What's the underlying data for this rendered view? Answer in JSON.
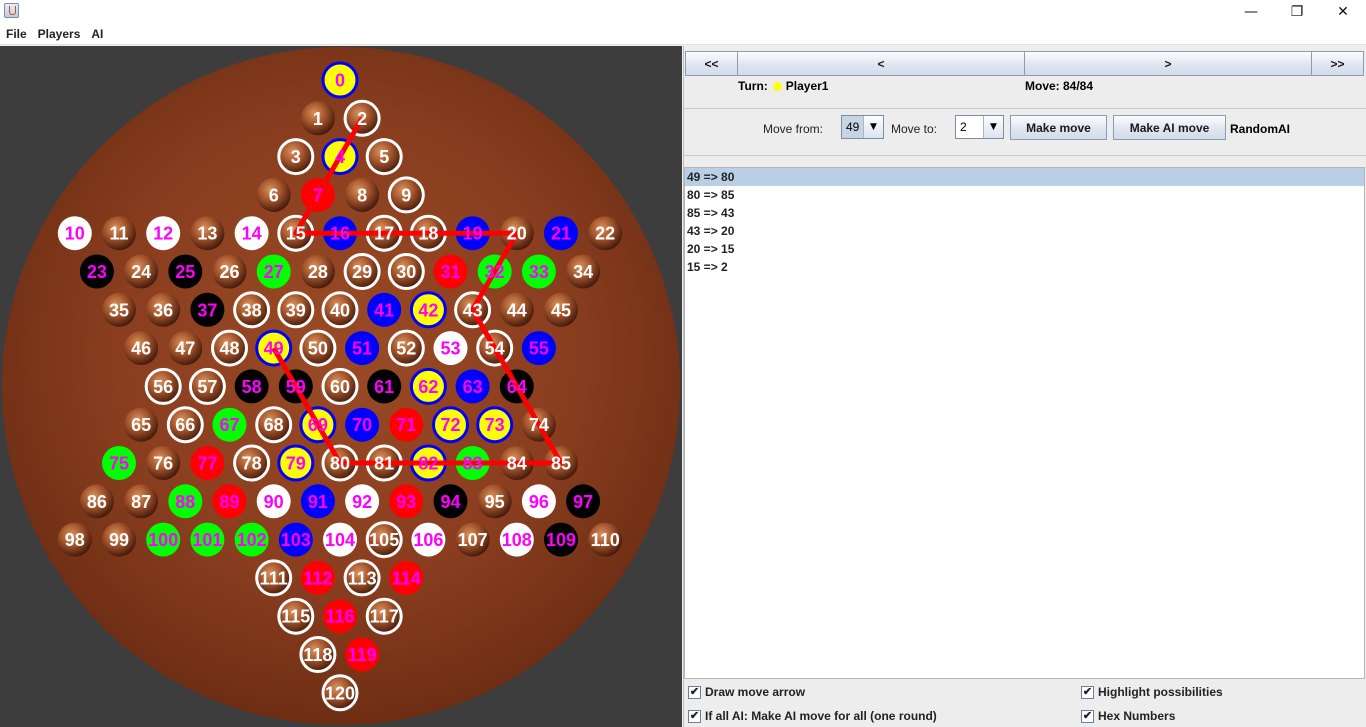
{
  "window": {
    "title": "",
    "min_glyph": "—",
    "restore_glyph": "❐",
    "close_glyph": "✕"
  },
  "menu": [
    "File",
    "Players",
    "AI"
  ],
  "nav": {
    "first": "<<",
    "prev": "<",
    "next": ">",
    "last": ">>"
  },
  "status": {
    "turn_label": "Turn:",
    "player": "Player1",
    "player_color": "#ffff00",
    "move_label": "Move: 84/84"
  },
  "controls": {
    "move_from_label": "Move from:",
    "move_from_value": "49",
    "move_to_label": "Move to:",
    "move_to_value": "2",
    "make_move": "Make move",
    "make_ai_move": "Make AI move",
    "ai_name": "RandomAI"
  },
  "history": [
    "49 => 80",
    "80 => 85",
    "85 => 43",
    "43 => 20",
    "20 => 15",
    "15 => 2"
  ],
  "history_selected": 0,
  "options": {
    "draw_arrow": "Draw move arrow",
    "highlight": "Highlight possibilities",
    "ai_all": "If all AI: Make AI move for all (one round)",
    "hex": "Hex Numbers"
  },
  "board": {
    "colors": {
      "yellow": "#ffff00",
      "blue": "#0000ff",
      "red": "#ff0000",
      "green": "#00ff00",
      "black": "#000000",
      "white": "#ffffff",
      "label_magenta": "#ff00ff",
      "wood": "#8a3e1f",
      "path": "#ff0000"
    },
    "rows": [
      1,
      2,
      3,
      4,
      13,
      12,
      11,
      10,
      9,
      10,
      11,
      12,
      13,
      4,
      3,
      2,
      1
    ],
    "cells": [
      {
        "n": "0",
        "fill": "yellow",
        "ring": "blue"
      },
      {
        "n": "1",
        "fill": "empty"
      },
      {
        "n": "2",
        "fill": "empty",
        "ring": "white"
      },
      {
        "n": "3",
        "fill": "empty",
        "ring": "white"
      },
      {
        "n": "4",
        "fill": "yellow",
        "ring": "blue"
      },
      {
        "n": "5",
        "fill": "empty",
        "ring": "white"
      },
      {
        "n": "6",
        "fill": "empty"
      },
      {
        "n": "7",
        "fill": "red"
      },
      {
        "n": "8",
        "fill": "empty"
      },
      {
        "n": "9",
        "fill": "empty",
        "ring": "white"
      },
      {
        "n": "10",
        "fill": "white"
      },
      {
        "n": "11",
        "fill": "empty"
      },
      {
        "n": "12",
        "fill": "white"
      },
      {
        "n": "13",
        "fill": "empty"
      },
      {
        "n": "14",
        "fill": "white"
      },
      {
        "n": "15",
        "fill": "empty",
        "ring": "white"
      },
      {
        "n": "16",
        "fill": "blue"
      },
      {
        "n": "17",
        "fill": "empty",
        "ring": "white"
      },
      {
        "n": "18",
        "fill": "empty",
        "ring": "white"
      },
      {
        "n": "19",
        "fill": "blue"
      },
      {
        "n": "20",
        "fill": "empty"
      },
      {
        "n": "21",
        "fill": "blue"
      },
      {
        "n": "22",
        "fill": "empty"
      },
      {
        "n": "23",
        "fill": "black"
      },
      {
        "n": "24",
        "fill": "empty"
      },
      {
        "n": "25",
        "fill": "black"
      },
      {
        "n": "26",
        "fill": "empty"
      },
      {
        "n": "27",
        "fill": "green"
      },
      {
        "n": "28",
        "fill": "empty"
      },
      {
        "n": "29",
        "fill": "empty",
        "ring": "white"
      },
      {
        "n": "30",
        "fill": "empty",
        "ring": "white"
      },
      {
        "n": "31",
        "fill": "red"
      },
      {
        "n": "32",
        "fill": "green"
      },
      {
        "n": "33",
        "fill": "green"
      },
      {
        "n": "34",
        "fill": "empty"
      },
      {
        "n": "35",
        "fill": "empty"
      },
      {
        "n": "36",
        "fill": "empty"
      },
      {
        "n": "37",
        "fill": "black"
      },
      {
        "n": "38",
        "fill": "empty",
        "ring": "white"
      },
      {
        "n": "39",
        "fill": "empty",
        "ring": "white"
      },
      {
        "n": "40",
        "fill": "empty",
        "ring": "white"
      },
      {
        "n": "41",
        "fill": "blue"
      },
      {
        "n": "42",
        "fill": "yellow",
        "ring": "blue"
      },
      {
        "n": "43",
        "fill": "empty",
        "ring": "white"
      },
      {
        "n": "44",
        "fill": "empty"
      },
      {
        "n": "45",
        "fill": "empty"
      },
      {
        "n": "46",
        "fill": "empty"
      },
      {
        "n": "47",
        "fill": "empty"
      },
      {
        "n": "48",
        "fill": "empty",
        "ring": "white"
      },
      {
        "n": "49",
        "fill": "yellow",
        "ring": "blue"
      },
      {
        "n": "50",
        "fill": "empty",
        "ring": "white"
      },
      {
        "n": "51",
        "fill": "blue"
      },
      {
        "n": "52",
        "fill": "empty",
        "ring": "white"
      },
      {
        "n": "53",
        "fill": "white"
      },
      {
        "n": "54",
        "fill": "empty",
        "ring": "white"
      },
      {
        "n": "55",
        "fill": "blue"
      },
      {
        "n": "56",
        "fill": "empty",
        "ring": "white"
      },
      {
        "n": "57",
        "fill": "empty",
        "ring": "white"
      },
      {
        "n": "58",
        "fill": "black"
      },
      {
        "n": "59",
        "fill": "black"
      },
      {
        "n": "60",
        "fill": "empty",
        "ring": "white"
      },
      {
        "n": "61",
        "fill": "black"
      },
      {
        "n": "62",
        "fill": "yellow",
        "ring": "blue"
      },
      {
        "n": "63",
        "fill": "blue"
      },
      {
        "n": "64",
        "fill": "black"
      },
      {
        "n": "65",
        "fill": "empty"
      },
      {
        "n": "66",
        "fill": "empty",
        "ring": "white"
      },
      {
        "n": "67",
        "fill": "green"
      },
      {
        "n": "68",
        "fill": "empty",
        "ring": "white"
      },
      {
        "n": "69",
        "fill": "yellow",
        "ring": "blue"
      },
      {
        "n": "70",
        "fill": "blue"
      },
      {
        "n": "71",
        "fill": "red"
      },
      {
        "n": "72",
        "fill": "yellow",
        "ring": "blue"
      },
      {
        "n": "73",
        "fill": "yellow",
        "ring": "blue"
      },
      {
        "n": "74",
        "fill": "empty"
      },
      {
        "n": "75",
        "fill": "green"
      },
      {
        "n": "76",
        "fill": "empty"
      },
      {
        "n": "77",
        "fill": "red"
      },
      {
        "n": "78",
        "fill": "empty",
        "ring": "white"
      },
      {
        "n": "79",
        "fill": "yellow",
        "ring": "blue"
      },
      {
        "n": "80",
        "fill": "empty",
        "ring": "white"
      },
      {
        "n": "81",
        "fill": "empty",
        "ring": "white"
      },
      {
        "n": "82",
        "fill": "yellow",
        "ring": "blue"
      },
      {
        "n": "83",
        "fill": "green"
      },
      {
        "n": "84",
        "fill": "empty"
      },
      {
        "n": "85",
        "fill": "empty"
      },
      {
        "n": "86",
        "fill": "empty"
      },
      {
        "n": "87",
        "fill": "empty"
      },
      {
        "n": "88",
        "fill": "green"
      },
      {
        "n": "89",
        "fill": "red"
      },
      {
        "n": "90",
        "fill": "white"
      },
      {
        "n": "91",
        "fill": "blue"
      },
      {
        "n": "92",
        "fill": "white"
      },
      {
        "n": "93",
        "fill": "red"
      },
      {
        "n": "94",
        "fill": "black"
      },
      {
        "n": "95",
        "fill": "empty"
      },
      {
        "n": "96",
        "fill": "white"
      },
      {
        "n": "97",
        "fill": "black"
      },
      {
        "n": "98",
        "fill": "empty"
      },
      {
        "n": "99",
        "fill": "empty"
      },
      {
        "n": "100",
        "fill": "green"
      },
      {
        "n": "101",
        "fill": "green"
      },
      {
        "n": "102",
        "fill": "green"
      },
      {
        "n": "103",
        "fill": "blue"
      },
      {
        "n": "104",
        "fill": "white"
      },
      {
        "n": "105",
        "fill": "empty",
        "ring": "white"
      },
      {
        "n": "106",
        "fill": "white"
      },
      {
        "n": "107",
        "fill": "empty"
      },
      {
        "n": "108",
        "fill": "white"
      },
      {
        "n": "109",
        "fill": "black"
      },
      {
        "n": "110",
        "fill": "empty"
      },
      {
        "n": "111",
        "fill": "empty",
        "ring": "white"
      },
      {
        "n": "112",
        "fill": "red"
      },
      {
        "n": "113",
        "fill": "empty",
        "ring": "white"
      },
      {
        "n": "114",
        "fill": "red"
      },
      {
        "n": "115",
        "fill": "empty",
        "ring": "white"
      },
      {
        "n": "116",
        "fill": "red"
      },
      {
        "n": "117",
        "fill": "empty",
        "ring": "white"
      },
      {
        "n": "118",
        "fill": "empty",
        "ring": "white"
      },
      {
        "n": "119",
        "fill": "red"
      },
      {
        "n": "120",
        "fill": "empty",
        "ring": "white"
      }
    ],
    "move_path": [
      "49",
      "80",
      "85",
      "43",
      "20",
      "15",
      "2"
    ]
  }
}
